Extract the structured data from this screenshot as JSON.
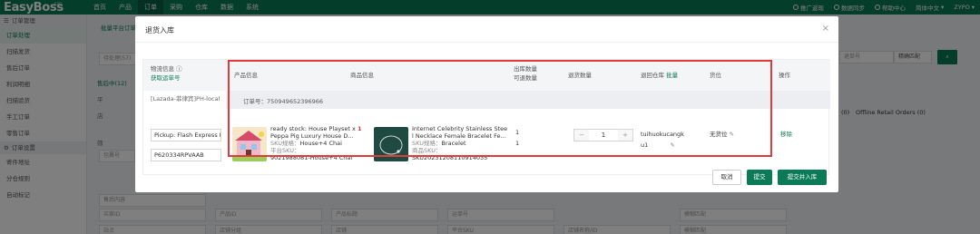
{
  "app": {
    "logo": "EasyBoss",
    "logo_sup": "ERP",
    "nav": [
      "首页",
      "产品",
      "订单",
      "采购",
      "仓库",
      "数据",
      "系统"
    ],
    "top_right": [
      "推广返现",
      "数据同步",
      "帮助中心",
      "简体中文",
      "ZYPO"
    ]
  },
  "sidebar": {
    "group1": "订单管理",
    "items": [
      "订单处理",
      "扫描发货",
      "售后订单",
      "利润明细",
      "扫描验货",
      "手工订单",
      "零售订单"
    ],
    "group2": "订单设置",
    "items2": [
      "寄件地址",
      "分仓规则",
      "自动标记"
    ]
  },
  "background": {
    "breadcrumb": "批量平台订单",
    "tab_pending": "待处理(57)",
    "status_tab": "售后中(12)",
    "label_platform": "平",
    "label_store": "店",
    "label_filter": "筛",
    "search_placeholder": "退单号",
    "exact_match": "精确匹配",
    "offline_retail": "Offline Retail Orders (0)",
    "row_count": "(0)",
    "fields_row1": [
      "售后内容",
      "全部",
      "全部",
      "全部"
    ],
    "fields_row2": [
      "买家ID",
      "产品ID",
      "产品标题",
      "运单号",
      "模糊匹配"
    ],
    "fields_row3": [
      "站点",
      "店铺分组",
      "店铺",
      "平台SKU",
      "店铺名称/ID",
      "模糊匹配"
    ]
  },
  "modal": {
    "title": "退货入库",
    "close_label": "×",
    "logistics_header": "物流信息",
    "get_tracking": "获取运单号",
    "store_name": "[Lazada-菲律宾]PH-local",
    "headers": {
      "product_info": "产品信息",
      "goods_info": "商品信息",
      "qty_out": "出库数量",
      "qty_avail": "可退数量",
      "return_qty": "退货数量",
      "return_wh": "退回仓库",
      "batch": "批量",
      "location": "货位",
      "action": "操作"
    },
    "order_no": "订单号：750949652396966",
    "ship_method": "Pickup: Flash Express I",
    "tracking": "P620334RPVAAB",
    "product": {
      "title1": "ready stock: House Playset x",
      "qty_badge": "1",
      "title2": "Peppa Pig Luxury House D...",
      "sku_spec": "SKU规格：",
      "sku_spec_value": "House+4 Chai",
      "platform_sku_label": "平台SKU：",
      "platform_sku": "9021988081-House+4 Chai"
    },
    "goods": {
      "title1": "Internet Celebrity Stainless Stee",
      "title2": "l Necklace Female Bracelet Fe...",
      "sku_spec": "SKU规格：",
      "sku_spec_value": "Bracelet",
      "goods_sku_label": "商品SKU：",
      "goods_sku": "SKU20231208110914035"
    },
    "qty_out": "1",
    "qty_avail": "1",
    "stepper": {
      "minus": "−",
      "value": "1",
      "plus": "+"
    },
    "warehouse": "tuihuokucangk",
    "warehouse_line2": "u1",
    "location": "无货位",
    "remove": "移除",
    "buttons": {
      "cancel": "取消",
      "submit": "提交",
      "submit_stock": "提交并入库"
    }
  },
  "colors": {
    "brand": "#0b7a56",
    "highlight": "#e03c3c"
  }
}
